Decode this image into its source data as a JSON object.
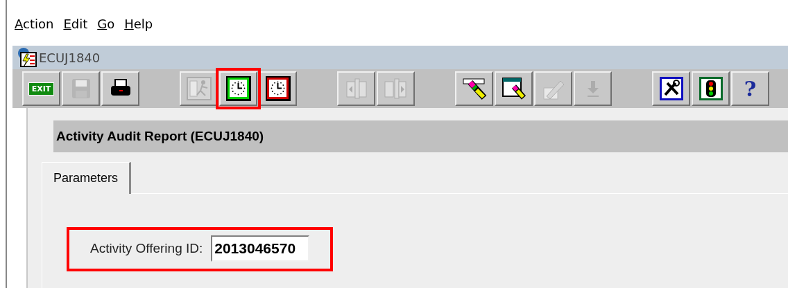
{
  "menu": [
    "Action",
    "Edit",
    "Go",
    "Help"
  ],
  "window": {
    "title": "ECUJ1840"
  },
  "toolbar": [
    [
      {
        "kind": "exit",
        "label": "EXIT",
        "disabled": false,
        "highlighted": false
      },
      {
        "kind": "save",
        "disabled": true,
        "highlighted": false
      },
      {
        "kind": "print",
        "disabled": false,
        "highlighted": false
      }
    ],
    [
      {
        "kind": "run",
        "disabled": true,
        "highlighted": false
      },
      {
        "kind": "clock-green",
        "disabled": false,
        "highlighted": true
      },
      {
        "kind": "clock-red",
        "disabled": false,
        "highlighted": false
      }
    ],
    [
      {
        "kind": "book-left",
        "disabled": true,
        "highlighted": false
      },
      {
        "kind": "book-right",
        "disabled": true,
        "highlighted": false
      }
    ],
    [
      {
        "kind": "eraser",
        "disabled": false,
        "highlighted": false
      },
      {
        "kind": "window-eraser",
        "disabled": false,
        "highlighted": false
      },
      {
        "kind": "pencil",
        "disabled": true,
        "highlighted": false
      },
      {
        "kind": "down-arrow",
        "disabled": true,
        "highlighted": false
      }
    ],
    [
      {
        "kind": "tools",
        "disabled": false,
        "highlighted": false
      },
      {
        "kind": "traffic-light",
        "disabled": false,
        "highlighted": false
      },
      {
        "kind": "help",
        "label": "?",
        "disabled": false,
        "highlighted": false
      }
    ]
  ],
  "form": {
    "heading": "Activity Audit Report (ECUJ1840)",
    "tabs": [
      {
        "label": "Parameters",
        "selected": true
      }
    ],
    "fields": [
      {
        "label": "Activity Offering ID:",
        "value": "2013046570",
        "highlighted": true
      }
    ]
  }
}
